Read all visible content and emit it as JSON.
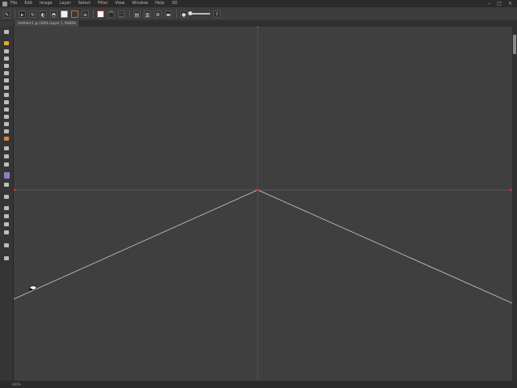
{
  "menubar": {
    "items": [
      "File",
      "Edit",
      "Image",
      "Layer",
      "Select",
      "Filter",
      "View",
      "Window",
      "Help",
      "3D"
    ]
  },
  "window_controls": [
    "–",
    "▢",
    "×"
  ],
  "tab": {
    "label": "Untitled-1 @ 100% (Layer 1, RGB/8)"
  },
  "status": {
    "zoom": "100%"
  },
  "colors": {
    "canvas": "#3f3f3f",
    "guide": "#5a5a5a",
    "anchor": "#d8302a",
    "path": "#c8c8c8",
    "foreground": "#e3a92b",
    "accent_tool": "#8583c4"
  },
  "icons": {
    "toolbar": [
      "pen-tool-icon",
      "path-mode-icon",
      "rotate-icon",
      "combine-icon",
      "subtract-icon",
      "fill-swatch-icon",
      "stroke-swatch-icon",
      "align-icon",
      "warp-icon",
      "transform-icon",
      "arrange-icon",
      "distribute-icon",
      "settings-icon",
      "stroke-width-icon",
      "lock-icon",
      "help-icon"
    ],
    "cursor": "pen-cursor-icon"
  }
}
